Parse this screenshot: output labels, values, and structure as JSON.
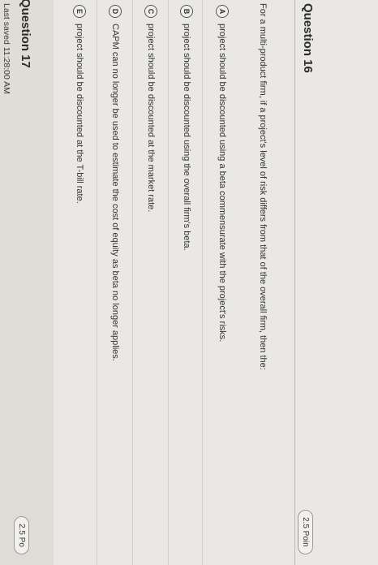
{
  "question16": {
    "title": "Question 16",
    "points": "2.5 Poin",
    "prompt": "For a multi-product firm, if a project's level of risk differs from that of the overall firm, then the:",
    "choices": [
      {
        "letter": "A",
        "text": "project should be discounted using a beta commensurate with the project's risks."
      },
      {
        "letter": "B",
        "text": "project should be discounted using the overall firm's beta."
      },
      {
        "letter": "C",
        "text": "project should be discounted at the market rate."
      },
      {
        "letter": "D",
        "text": "CAPM can no longer be used to estimate the cost of equity as beta no longer applies."
      },
      {
        "letter": "E",
        "text": "project should be discounted at the T-bill rate."
      }
    ]
  },
  "question17": {
    "title": "Question 17",
    "points": "2.5 Po"
  },
  "status": {
    "last_saved": "Last saved 11:28:00 AM"
  }
}
